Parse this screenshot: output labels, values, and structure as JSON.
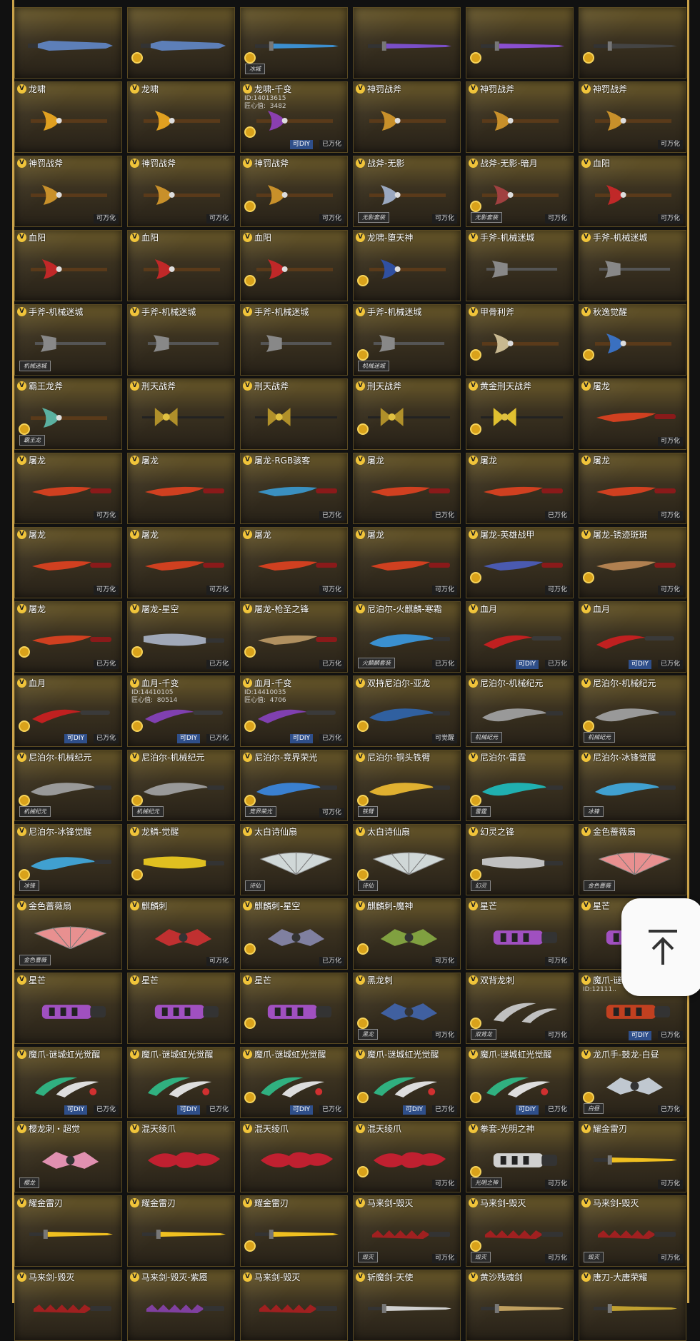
{
  "scroll_top_label": "回到顶部",
  "items": [
    {
      "name": "",
      "color": "#5d7fb8",
      "shape": "dagger",
      "top": true
    },
    {
      "name": "",
      "color": "#5d7fb8",
      "shape": "dagger",
      "coin": true,
      "top": true
    },
    {
      "name": "",
      "color": "#3c8fd0",
      "shape": "sword",
      "coin": true,
      "tag": "冰城",
      "top": true
    },
    {
      "name": "",
      "color": "#7a4fc8",
      "shape": "sword",
      "top": true
    },
    {
      "name": "",
      "color": "#8a4fd0",
      "shape": "sword",
      "coin": true,
      "top": true
    },
    {
      "name": "",
      "color": "#444",
      "shape": "sword",
      "coin": true,
      "top": true
    },
    {
      "name": "龙啸",
      "color": "#e0a020",
      "shape": "axe"
    },
    {
      "name": "龙啸",
      "color": "#e0a020",
      "shape": "axe"
    },
    {
      "name": "龙啸-千变",
      "sub": "ID:14013615\n匠心值:  3482",
      "color": "#8a3fb0",
      "shape": "axe",
      "coin": true,
      "diy": "可DIY",
      "status": "已万化"
    },
    {
      "name": "神罚战斧",
      "color": "#c8902a",
      "shape": "axe"
    },
    {
      "name": "神罚战斧",
      "color": "#c8902a",
      "shape": "axe"
    },
    {
      "name": "神罚战斧",
      "color": "#c8902a",
      "shape": "axe",
      "status": "可万化"
    },
    {
      "name": "神罚战斧",
      "color": "#c8902a",
      "shape": "axe",
      "status": "可万化"
    },
    {
      "name": "神罚战斧",
      "color": "#c8902a",
      "shape": "axe",
      "status": "可万化"
    },
    {
      "name": "神罚战斧",
      "color": "#c8902a",
      "shape": "axe",
      "coin": true,
      "status": "可万化"
    },
    {
      "name": "战斧-无影",
      "color": "#9aa8c0",
      "shape": "axe",
      "tag": "无影套装",
      "status": "可万化"
    },
    {
      "name": "战斧-无影-暗月",
      "color": "#a04040",
      "shape": "axe",
      "coin": true,
      "tag": "无影套装",
      "status": "可万化"
    },
    {
      "name": "血阳",
      "color": "#c02828",
      "shape": "axe",
      "status": "可万化"
    },
    {
      "name": "血阳",
      "color": "#c02828",
      "shape": "axe"
    },
    {
      "name": "血阳",
      "color": "#c02828",
      "shape": "axe"
    },
    {
      "name": "血阳",
      "color": "#c02828",
      "shape": "axe",
      "coin": true
    },
    {
      "name": "龙啸-堕天神",
      "color": "#3050a0",
      "shape": "axe",
      "coin": true
    },
    {
      "name": "手斧-机械迷城",
      "color": "#888",
      "shape": "hatchet"
    },
    {
      "name": "手斧-机械迷城",
      "color": "#888",
      "shape": "hatchet"
    },
    {
      "name": "手斧-机械迷城",
      "color": "#888",
      "shape": "hatchet",
      "tag": "机械迷城"
    },
    {
      "name": "手斧-机械迷城",
      "color": "#888",
      "shape": "hatchet"
    },
    {
      "name": "手斧-机械迷城",
      "color": "#888",
      "shape": "hatchet"
    },
    {
      "name": "手斧-机械迷城",
      "color": "#888",
      "shape": "hatchet",
      "coin": true,
      "tag": "机械迷城"
    },
    {
      "name": "甲骨利斧",
      "color": "#c8b890",
      "shape": "axe",
      "coin": true
    },
    {
      "name": "秋逸觉醒",
      "color": "#3a70c0",
      "shape": "axe",
      "coin": true
    },
    {
      "name": "霸王龙斧",
      "color": "#5ab0a0",
      "shape": "axe",
      "coin": true,
      "tag": "霸王龙"
    },
    {
      "name": "刑天战斧",
      "color": "#b0902a",
      "shape": "staff"
    },
    {
      "name": "刑天战斧",
      "color": "#b0902a",
      "shape": "staff"
    },
    {
      "name": "刑天战斧",
      "color": "#b0902a",
      "shape": "staff",
      "coin": true
    },
    {
      "name": "黄金刑天战斧",
      "color": "#e0c030",
      "shape": "staff",
      "coin": true
    },
    {
      "name": "屠龙",
      "color": "#d04020",
      "shape": "knife",
      "status": "可万化"
    },
    {
      "name": "屠龙",
      "color": "#d04020",
      "shape": "knife",
      "status": "可万化"
    },
    {
      "name": "屠龙",
      "color": "#d04020",
      "shape": "knife"
    },
    {
      "name": "屠龙-RGB骇客",
      "color": "#3a90c0",
      "shape": "knife",
      "status": "已万化"
    },
    {
      "name": "屠龙",
      "color": "#d04020",
      "shape": "knife",
      "status": "已万化"
    },
    {
      "name": "屠龙",
      "color": "#d04020",
      "shape": "knife",
      "status": "已万化"
    },
    {
      "name": "屠龙",
      "color": "#d04020",
      "shape": "knife",
      "status": "可万化"
    },
    {
      "name": "屠龙",
      "color": "#d04020",
      "shape": "knife",
      "status": "可万化"
    },
    {
      "name": "屠龙",
      "color": "#d04020",
      "shape": "knife",
      "status": "可万化"
    },
    {
      "name": "屠龙",
      "color": "#d04020",
      "shape": "knife",
      "status": "可万化"
    },
    {
      "name": "屠龙",
      "color": "#d04020",
      "shape": "knife",
      "status": "可万化"
    },
    {
      "name": "屠龙-英雄战甲",
      "color": "#4a5ab0",
      "shape": "knife",
      "coin": true,
      "status": "可万化"
    },
    {
      "name": "屠龙-锈迹斑斑",
      "color": "#b08050",
      "shape": "knife",
      "coin": true,
      "status": "可万化"
    },
    {
      "name": "屠龙",
      "color": "#d04020",
      "shape": "knife",
      "coin": true,
      "status": "已万化"
    },
    {
      "name": "屠龙-星空",
      "color": "#a0a8b8",
      "shape": "machete",
      "coin": true,
      "status": "已万化"
    },
    {
      "name": "屠龙-枪圣之锋",
      "color": "#b09060",
      "shape": "knife",
      "coin": true,
      "status": "已万化"
    },
    {
      "name": "尼泊尔-火麒麟-寒霜",
      "color": "#3a90d0",
      "shape": "kukri",
      "tag": "火麒麟套装",
      "status": "已万化"
    },
    {
      "name": "血月",
      "color": "#c02020",
      "shape": "curved",
      "diy": "可DIY",
      "status": "已万化"
    },
    {
      "name": "血月",
      "color": "#c02020",
      "shape": "curved",
      "diy": "可DIY",
      "status": "已万化"
    },
    {
      "name": "血月",
      "color": "#c02020",
      "shape": "curved",
      "coin": true,
      "diy": "可DIY",
      "status": "已万化"
    },
    {
      "name": "血月-千变",
      "sub": "ID:14410105\n匠心值:  80514",
      "color": "#8040b0",
      "shape": "curved",
      "coin": true,
      "diy": "可DIY",
      "status": "已万化"
    },
    {
      "name": "血月-千变",
      "sub": "ID:14410035\n匠心值:  4706",
      "color": "#8040b0",
      "shape": "curved",
      "coin": true,
      "diy": "可DIY",
      "status": "已万化"
    },
    {
      "name": "双持尼泊尔-亚龙",
      "color": "#3060a0",
      "shape": "kukri",
      "coin": true,
      "status": "可觉醒"
    },
    {
      "name": "尼泊尔-机械纪元",
      "color": "#999",
      "shape": "kukri",
      "tag": "机械纪元"
    },
    {
      "name": "尼泊尔-机械纪元",
      "color": "#999",
      "shape": "kukri",
      "coin": true,
      "tag": "机械纪元"
    },
    {
      "name": "尼泊尔-机械纪元",
      "color": "#999",
      "shape": "kukri",
      "coin": true,
      "tag": "机械纪元"
    },
    {
      "name": "尼泊尔-机械纪元",
      "color": "#999",
      "shape": "kukri",
      "coin": true,
      "tag": "机械纪元"
    },
    {
      "name": "尼泊尔-竞界荣光",
      "color": "#3a80d0",
      "shape": "kukri",
      "coin": true,
      "tag": "竞界荣光",
      "status": "可万化"
    },
    {
      "name": "尼泊尔-铜头铁臂",
      "color": "#e0b030",
      "shape": "kukri",
      "coin": true,
      "tag": "铁臂"
    },
    {
      "name": "尼泊尔-雷霆",
      "color": "#20b0b0",
      "shape": "kukri",
      "coin": true,
      "tag": "雷霆"
    },
    {
      "name": "尼泊尔-冰锋觉醒",
      "color": "#40a0d0",
      "shape": "kukri",
      "tag": "冰锋"
    },
    {
      "name": "尼泊尔-冰锋觉醒",
      "color": "#40a0d0",
      "shape": "kukri",
      "coin": true,
      "tag": "冰锋"
    },
    {
      "name": "龙鳞-觉醒",
      "color": "#e0c020",
      "shape": "machete",
      "coin": true
    },
    {
      "name": "太白诗仙扇",
      "color": "#d0d8d8",
      "shape": "fan",
      "tag": "诗仙"
    },
    {
      "name": "太白诗仙扇",
      "color": "#d0d8d8",
      "shape": "fan",
      "coin": true,
      "tag": "诗仙"
    },
    {
      "name": "幻灵之锋",
      "color": "#c0c0c0",
      "shape": "machete",
      "coin": true,
      "tag": "幻灵"
    },
    {
      "name": "金色蔷薇扇",
      "color": "#e89090",
      "shape": "fan",
      "tag": "金色蔷薇"
    },
    {
      "name": "金色蔷薇扇",
      "color": "#e89090",
      "shape": "fan",
      "tag": "金色蔷薇"
    },
    {
      "name": "麒麟刺",
      "color": "#c03030",
      "shape": "claw",
      "status": "可万化"
    },
    {
      "name": "麒麟刺-星空",
      "color": "#8080a0",
      "shape": "claw",
      "coin": true,
      "status": "已万化"
    },
    {
      "name": "麒麟刺-魔神",
      "color": "#80a040",
      "shape": "claw",
      "coin": true,
      "status": "可万化"
    },
    {
      "name": "星芒",
      "color": "#a050c0",
      "shape": "gauntlet",
      "status": "可万化"
    },
    {
      "name": "星芒",
      "color": "#a050c0",
      "shape": "gauntlet"
    },
    {
      "name": "星芒",
      "color": "#a050c0",
      "shape": "gauntlet"
    },
    {
      "name": "星芒",
      "color": "#a050c0",
      "shape": "gauntlet"
    },
    {
      "name": "星芒",
      "color": "#a050c0",
      "shape": "gauntlet",
      "coin": true
    },
    {
      "name": "黑龙刺",
      "color": "#4060a0",
      "shape": "claw",
      "coin": true,
      "tag": "黑龙",
      "status": "可万化"
    },
    {
      "name": "双背龙刺",
      "color": "#c0c0c0",
      "shape": "scythe",
      "coin": true,
      "tag": "双背龙",
      "status": "可万化"
    },
    {
      "name": "魔爪-谜城虹光觉醒",
      "sub": "ID:12111..",
      "color": "#c04020",
      "shape": "gauntlet",
      "diy": "可DIY",
      "status": "已万化"
    },
    {
      "name": "魔爪-谜城虹光觉醒",
      "color": "#30b080",
      "shape": "talon",
      "diy": "可DIY",
      "status": "已万化"
    },
    {
      "name": "魔爪-谜城虹光觉醒",
      "color": "#30b080",
      "shape": "talon",
      "diy": "可DIY",
      "status": "已万化"
    },
    {
      "name": "魔爪-谜城虹光觉醒",
      "color": "#30b080",
      "shape": "talon",
      "coin": true,
      "diy": "可DIY",
      "status": "已万化"
    },
    {
      "name": "魔爪-谜城虹光觉醒",
      "color": "#30b080",
      "shape": "talon",
      "coin": true,
      "diy": "可DIY",
      "status": "已万化"
    },
    {
      "name": "魔爪-谜城虹光觉醒",
      "color": "#30b080",
      "shape": "talon",
      "coin": true,
      "diy": "可DIY",
      "status": "已万化"
    },
    {
      "name": "龙爪手-鼓龙-白昼",
      "color": "#c0c8d0",
      "shape": "claw",
      "coin": true,
      "tag": "白昼",
      "status": "已万化"
    },
    {
      "name": "樱龙刺・超觉",
      "color": "#e090b0",
      "shape": "claw",
      "tag": "樱龙"
    },
    {
      "name": "混天绫爪",
      "color": "#c02030",
      "shape": "flame"
    },
    {
      "name": "混天绫爪",
      "color": "#c02030",
      "shape": "flame"
    },
    {
      "name": "混天绫爪",
      "color": "#c02030",
      "shape": "flame",
      "coin": true,
      "status": "可万化"
    },
    {
      "name": "拳套-光明之神",
      "color": "#d0d0d0",
      "shape": "gauntlet",
      "coin": true,
      "tag": "光明之神",
      "status": "可万化"
    },
    {
      "name": "耀金雷刃",
      "color": "#f0c020",
      "shape": "sword",
      "status": "可万化"
    },
    {
      "name": "耀金雷刃",
      "color": "#f0c020",
      "shape": "sword"
    },
    {
      "name": "耀金雷刃",
      "color": "#f0c020",
      "shape": "sword"
    },
    {
      "name": "耀金雷刃",
      "color": "#f0c020",
      "shape": "sword",
      "coin": true
    },
    {
      "name": "马来剑-毁灭",
      "color": "#a02020",
      "shape": "kris",
      "tag": "毁灭",
      "status": "可万化"
    },
    {
      "name": "马来剑-毁灭",
      "color": "#a02020",
      "shape": "kris",
      "coin": true,
      "tag": "毁灭",
      "status": "可万化"
    },
    {
      "name": "马来剑-毁灭",
      "color": "#a02020",
      "shape": "kris",
      "tag": "毁灭",
      "status": "可万化"
    },
    {
      "name": "马来剑-毁灭",
      "color": "#a02020",
      "shape": "kris"
    },
    {
      "name": "马来剑-毁灭-紫魇",
      "color": "#8040a0",
      "shape": "kris"
    },
    {
      "name": "马来剑-毁灭",
      "color": "#a02020",
      "shape": "kris"
    },
    {
      "name": "斩魔剑-天使",
      "color": "#d0d0d0",
      "shape": "sword"
    },
    {
      "name": "黄沙残魂剑",
      "color": "#c0a060",
      "shape": "sword"
    },
    {
      "name": "唐刀-大唐荣耀",
      "color": "#c0a030",
      "shape": "sword"
    }
  ]
}
